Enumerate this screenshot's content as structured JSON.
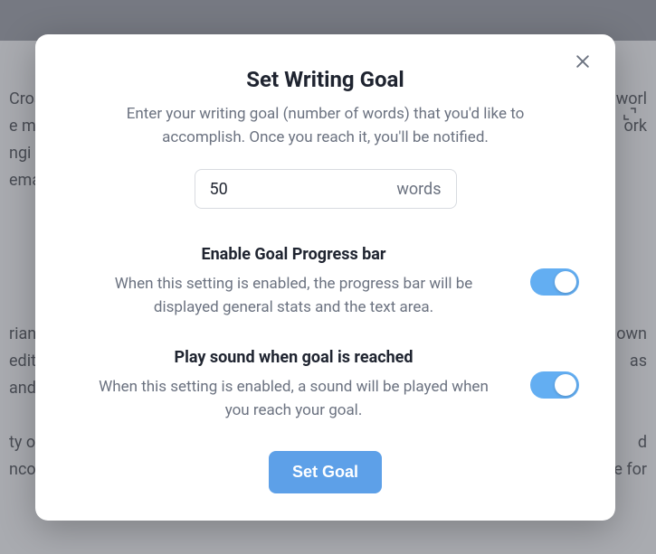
{
  "modal": {
    "title": "Set Writing Goal",
    "description": "Enter your writing goal (number of words) that you'd like to accomplish. Once you reach it, you'll be notified.",
    "goal_value": "50",
    "goal_unit": "words",
    "progress": {
      "title": "Enable Goal Progress bar",
      "description": "When this setting is enabled, the progress bar will be displayed general stats and the text area.",
      "enabled": true
    },
    "sound": {
      "title": "Play sound when goal is reached",
      "description": "When this setting is enabled, a sound will be played when you reach your goal.",
      "enabled": true
    },
    "submit_label": "Set Goal"
  },
  "background": {
    "line1": "Croat",
    "line2": "e mo",
    "line3": "ngi",
    "line4": "ema",
    "line5": "rian",
    "line6": "edit",
    "line7": "and",
    "line8": "ty of",
    "line9": "ncou",
    "r1": "worl",
    "r2": "ork",
    "r5": "own",
    "r6": "as",
    "r8": "d",
    "r9": "e for"
  }
}
